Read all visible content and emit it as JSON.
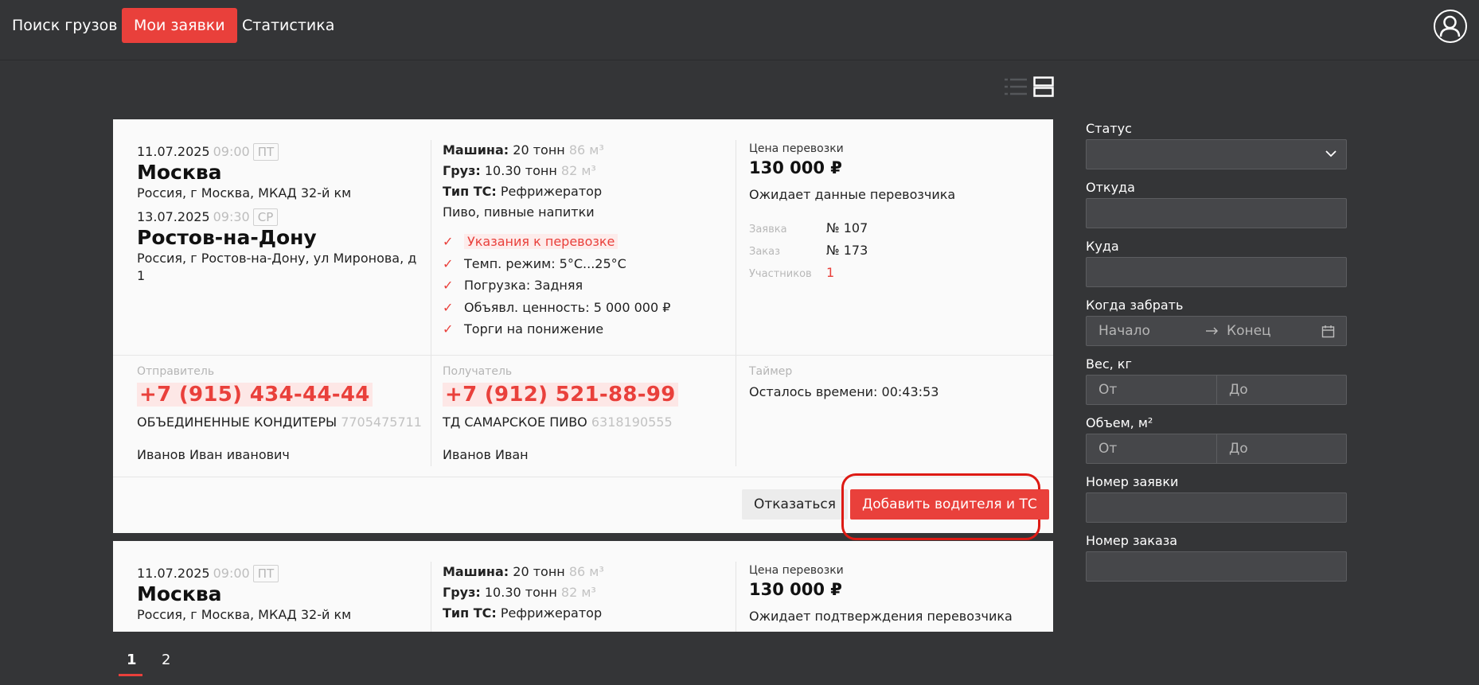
{
  "nav": {
    "items": [
      {
        "label": "Поиск грузов"
      },
      {
        "label": "Мои заявки"
      },
      {
        "label": "Статистика"
      }
    ]
  },
  "colors": {
    "accent": "#e9403b",
    "background": "#343537",
    "card": "#fafafa"
  },
  "icons": {
    "avatar": "user-circle-icon",
    "list_view": "list-view-icon",
    "card_view": "card-view-icon",
    "check": "check-icon",
    "chevron": "chevron-down-icon",
    "calendar": "calendar-icon",
    "arrow": "arrow-right-icon"
  },
  "cards": [
    {
      "pickup": {
        "date": "11.07.2025",
        "time": "09:00",
        "dow": "ПТ",
        "city": "Москва",
        "address": "Россия, г Москва, МКАД 32-й км"
      },
      "delivery": {
        "date": "13.07.2025",
        "time": "09:30",
        "dow": "СР",
        "city": "Ростов-на-Дону",
        "address": "Россия, г Ростов-на-Дону, ул Миронова, д 1"
      },
      "specs": {
        "machine_label": "Машина:",
        "machine_value": "20 тонн",
        "machine_volume": "86 м³",
        "cargo_label": "Груз:",
        "cargo_value": "10.30 тонн",
        "cargo_volume": "82 м³",
        "ts_label": "Тип ТС:",
        "ts_value": "Рефрижератор",
        "goods": "Пиво, пивные напитки"
      },
      "checks": [
        "Указания к перевозке",
        "Темп. режим: 5°C...25°C",
        "Погрузка: Задняя",
        "Объявл. ценность: 5 000 000 ₽",
        "Торги на понижение"
      ],
      "price_label": "Цена перевозки",
      "price": "130 000 ₽",
      "status": "Ожидает данные перевозчика",
      "meta": [
        {
          "key": "Заявка",
          "value": "№ 107"
        },
        {
          "key": "Заказ",
          "value": "№ 173"
        },
        {
          "key": "Участников",
          "value": "1"
        }
      ],
      "sender": {
        "label": "Отправитель",
        "phone": "+7 (915) 434-44-44",
        "company": "ОБЪЕДИНЕННЫЕ КОНДИТЕРЫ",
        "inn": "7705475711",
        "person": "Иванов Иван иванович"
      },
      "receiver": {
        "label": "Получатель",
        "phone": "+7 (912) 521-88-99",
        "company": "ТД САМАРСКОЕ ПИВО",
        "inn": "6318190555",
        "person": "Иванов Иван"
      },
      "timer": {
        "label": "Таймер",
        "text": "Осталось времени: 00:43:53"
      },
      "actions": {
        "decline": "Отказаться",
        "add_driver": "Добавить водителя и ТС"
      }
    },
    {
      "pickup": {
        "date": "11.07.2025",
        "time": "09:00",
        "dow": "ПТ",
        "city": "Москва",
        "address": "Россия, г Москва, МКАД 32-й км"
      },
      "specs": {
        "machine_label": "Машина:",
        "machine_value": "20 тонн",
        "machine_volume": "86 м³",
        "cargo_label": "Груз:",
        "cargo_value": "10.30 тонн",
        "cargo_volume": "82 м³",
        "ts_label": "Тип ТС:",
        "ts_value": "Рефрижератор"
      },
      "price_label": "Цена перевозки",
      "price": "130 000 ₽",
      "status": "Ожидает подтверждения перевозчика"
    }
  ],
  "filters": {
    "status_label": "Статус",
    "from_label": "Откуда",
    "to_label": "Куда",
    "when_label": "Когда забрать",
    "when_start_placeholder": "Начало",
    "when_end_placeholder": "Конец",
    "weight_label": "Вес, кг",
    "volume_label": "Объем, м²",
    "range_from": "От",
    "range_to": "До",
    "request_number_label": "Номер заявки",
    "order_number_label": "Номер заказа"
  },
  "pagination": {
    "pages": [
      "1",
      "2"
    ],
    "current": "1"
  }
}
